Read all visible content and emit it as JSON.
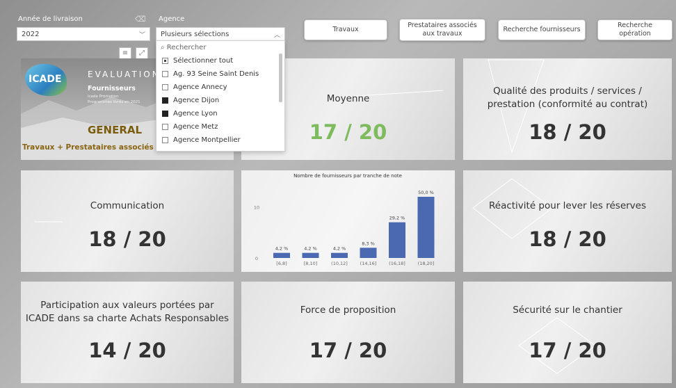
{
  "filters": {
    "year": {
      "label": "Année de livraison",
      "value": "2022"
    },
    "agency": {
      "label": "Agence",
      "value": "Plusieurs sélections",
      "search_placeholder": "Rechercher",
      "items": [
        {
          "label": "Sélectionner tout",
          "state": "partial"
        },
        {
          "label": "Ag. 93 Seine Saint Denis",
          "state": "off"
        },
        {
          "label": "Agence Annecy",
          "state": "off"
        },
        {
          "label": "Agence Dijon",
          "state": "on"
        },
        {
          "label": "Agence Lyon",
          "state": "on"
        },
        {
          "label": "Agence Metz",
          "state": "off"
        },
        {
          "label": "Agence Montpellier",
          "state": "off"
        }
      ]
    }
  },
  "nav": {
    "travaux": "Travaux",
    "prestataires": "Prestataires associés aux travaux",
    "fournisseurs": "Recherche fournisseurs",
    "operation": "Recherche opération"
  },
  "banner": {
    "logo": "ICADE",
    "evaluation": "EVALUATION",
    "fournisseurs": "Fournisseurs",
    "sub1": "Icade Promotion",
    "sub2": "Programmes livrés en 2021",
    "general": "GENERAL",
    "scope": "Travaux + Prestataires associés"
  },
  "cards": {
    "moyenne": {
      "title": "Moyenne",
      "score": "17 / 20"
    },
    "qualite": {
      "title": "Qualité des produits / services / prestation (conformité au contrat)",
      "score": "18 / 20"
    },
    "communication": {
      "title": "Communication",
      "score": "18 / 20"
    },
    "reactivite": {
      "title": "Réactivité pour lever les réserves",
      "score": "18 / 20"
    },
    "participation": {
      "title": "Participation aux valeurs portées par ICADE dans sa charte Achats Responsables",
      "score": "14 / 20"
    },
    "force": {
      "title": "Force de proposition",
      "score": "17 / 20"
    },
    "securite": {
      "title": "Sécurité sur le chantier",
      "score": "17 / 20"
    }
  },
  "colors": {
    "accent_green": "#7dbb5d",
    "bar_blue": "#4a69b0"
  },
  "chart_data": {
    "type": "bar",
    "title": "Nombre de fournisseurs par tranche de note",
    "categories": [
      "[6,8]",
      "[8,10]",
      "(10,12]",
      "(14,16]",
      "(16,18]",
      "(18,20]"
    ],
    "values": [
      1,
      1,
      1,
      2,
      7,
      12
    ],
    "data_labels": [
      "4,2 %",
      "4,2 %",
      "4,2 %",
      "8,3 %",
      "29,2 %",
      "50,0 %"
    ],
    "yticks": [
      "0",
      "10"
    ],
    "ylim": [
      0,
      12
    ],
    "grid": false
  }
}
